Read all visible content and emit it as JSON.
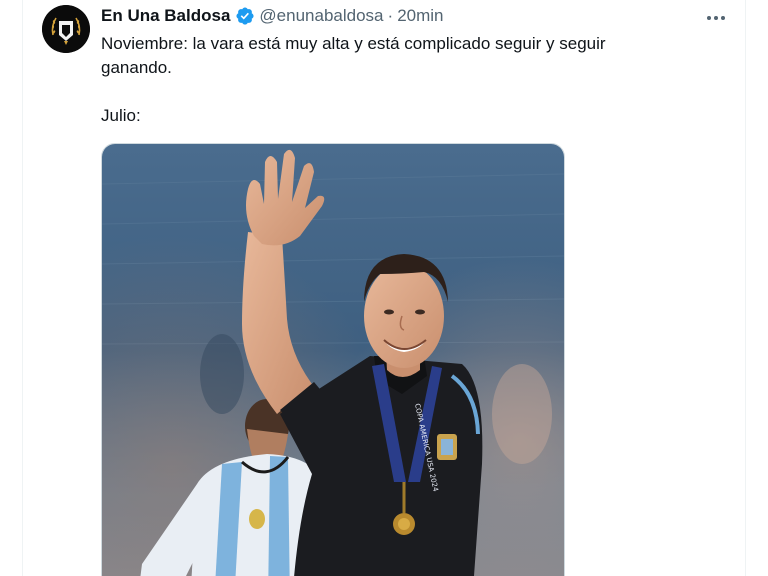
{
  "tweet": {
    "display_name": "En Una Baldosa",
    "handle": "@enunabaldosa",
    "separator": "·",
    "time": "20min",
    "verified": true,
    "avatar_icon": "en-una-baldosa-logo-icon",
    "text_lines": [
      "Noviembre: la vara está muy alta y está complicado seguir y seguir ganando.",
      "Julio:"
    ]
  },
  "media": {
    "medal_ribbon_text": "COPA AMERICA USA 2024"
  },
  "colors": {
    "text_primary": "#0f1419",
    "text_secondary": "#536471",
    "verified_blue": "#1d9bf0",
    "border": "#cfd9de"
  }
}
